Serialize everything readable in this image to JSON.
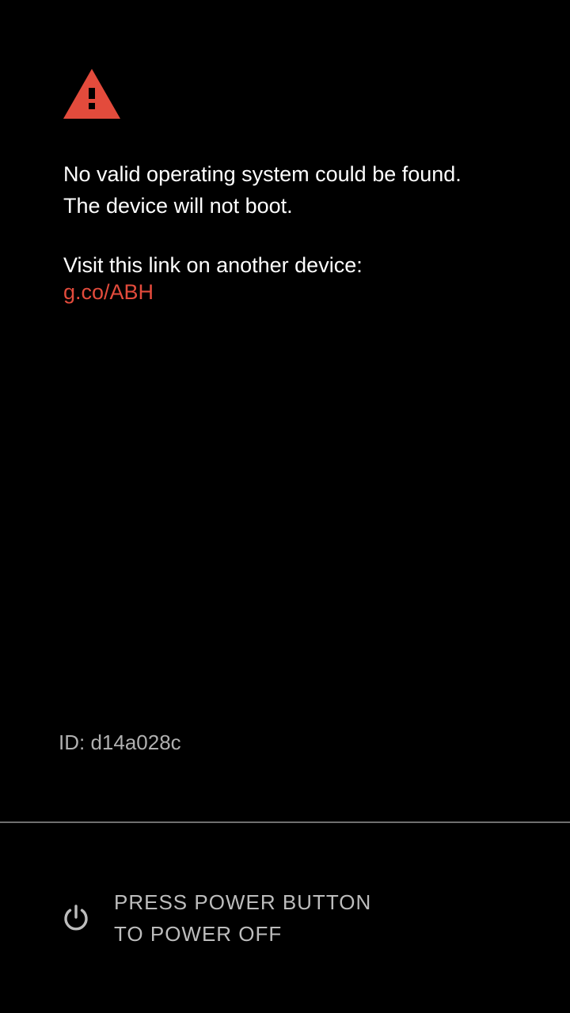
{
  "warning": {
    "icon": "warning-triangle-icon",
    "color": "#e34b3c"
  },
  "message": {
    "line1": "No valid operating system could be found.",
    "line2": "The device will not boot."
  },
  "visit": {
    "label": "Visit this link on another device:",
    "link_text": "g.co/ABH",
    "link_color": "#e34b3c"
  },
  "device": {
    "id_text": "ID: d14a028c"
  },
  "power": {
    "icon": "power-icon",
    "line1": "PRESS POWER BUTTON",
    "line2": "TO POWER OFF"
  },
  "colors": {
    "background": "#000000",
    "accent": "#e34b3c",
    "primary_text": "#ffffff",
    "secondary_text": "#bdbdbd"
  }
}
